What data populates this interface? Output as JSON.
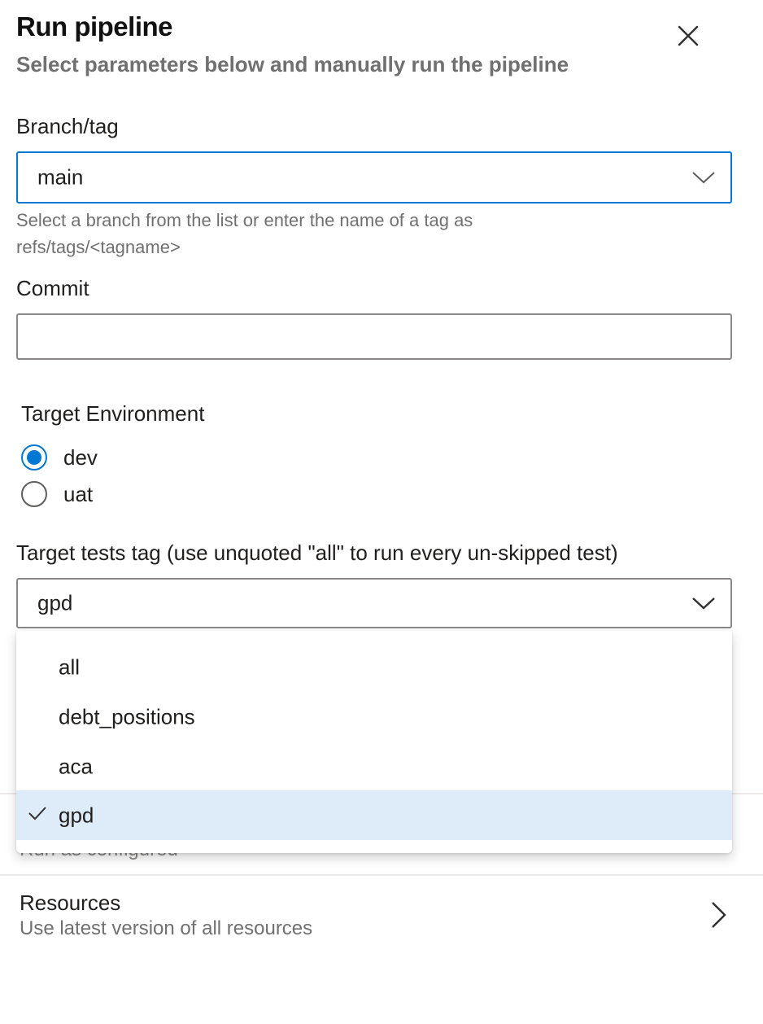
{
  "header": {
    "title": "Run pipeline",
    "subtitle": "Select parameters below and manually run the pipeline"
  },
  "branch": {
    "label": "Branch/tag",
    "value": "main",
    "hint": "Select a branch from the list or enter the name of a tag as refs/tags/<tagname>"
  },
  "commit": {
    "label": "Commit",
    "value": ""
  },
  "environment": {
    "label": "Target Environment",
    "options": [
      {
        "label": "dev",
        "checked": true
      },
      {
        "label": "uat",
        "checked": false
      }
    ]
  },
  "tests_tag": {
    "label": "Target tests tag (use unquoted \"all\" to run every un-skipped test)",
    "value": "gpd",
    "options": [
      {
        "label": "all",
        "selected": false
      },
      {
        "label": "debt_positions",
        "selected": false
      },
      {
        "label": "aca",
        "selected": false
      },
      {
        "label": "gpd",
        "selected": true
      }
    ]
  },
  "advanced": {
    "partial_text": "Run as configured"
  },
  "resources": {
    "title": "Resources",
    "subtitle": "Use latest version of all resources"
  },
  "colors": {
    "accent": "#0078d4",
    "selected_bg": "#deecf9",
    "muted_text": "#707070"
  },
  "icons": {
    "close": "close-icon",
    "dropdown": "chevron-down-icon",
    "selected": "checkmark-icon",
    "navigate": "chevron-right-icon"
  }
}
